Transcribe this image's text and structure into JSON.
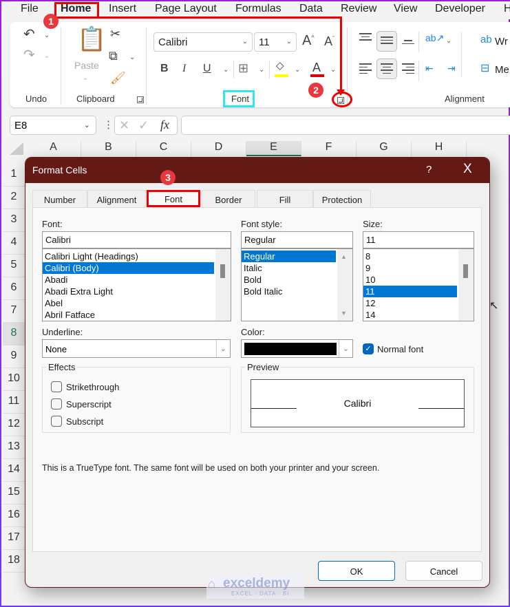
{
  "menu": {
    "tabs": [
      "File",
      "Home",
      "Insert",
      "Page Layout",
      "Formulas",
      "Data",
      "Review",
      "View",
      "Developer",
      "H"
    ],
    "active": "Home"
  },
  "ribbon": {
    "groups": {
      "undo": "Undo",
      "clipboard": "Clipboard",
      "font": "Font",
      "alignment": "Alignment"
    },
    "paste_label": "Paste",
    "font_name": "Calibri",
    "font_size": "11",
    "wrap_label": "Wr",
    "merge_label": "Me",
    "highlight_color": "#ffff00",
    "font_color": "#e00000"
  },
  "formula_bar": {
    "name_box": "E8",
    "formula": "",
    "fx_label": "fx"
  },
  "grid": {
    "columns": [
      "A",
      "B",
      "C",
      "D",
      "E",
      "F",
      "G",
      "H"
    ],
    "rows": [
      "1",
      "2",
      "3",
      "4",
      "5",
      "6",
      "7",
      "8",
      "9",
      "10",
      "11",
      "12",
      "13",
      "14",
      "15",
      "16",
      "17",
      "18"
    ],
    "active_column": "E",
    "active_row": "8"
  },
  "dialog": {
    "title": "Format Cells",
    "help": "?",
    "close": "X",
    "tabs": [
      "Number",
      "Alignment",
      "Font",
      "Border",
      "Fill",
      "Protection"
    ],
    "active_tab": "Font",
    "font_label": "Font:",
    "font_value": "Calibri",
    "font_list": [
      "Calibri Light (Headings)",
      "Calibri (Body)",
      "Abadi",
      "Abadi Extra Light",
      "Abel",
      "Abril Fatface"
    ],
    "font_selected": "Calibri (Body)",
    "style_label": "Font style:",
    "style_value": "Regular",
    "style_list": [
      "Regular",
      "Italic",
      "Bold",
      "Bold Italic"
    ],
    "style_selected": "Regular",
    "size_label": "Size:",
    "size_value": "11",
    "size_list": [
      "8",
      "9",
      "10",
      "11",
      "12",
      "14"
    ],
    "size_selected": "11",
    "underline_label": "Underline:",
    "underline_value": "None",
    "color_label": "Color:",
    "color_value": "#000000",
    "normal_font_label": "Normal font",
    "normal_font_checked": true,
    "effects_label": "Effects",
    "effects": [
      {
        "label": "Strikethrough",
        "checked": false
      },
      {
        "label": "Superscript",
        "checked": false
      },
      {
        "label": "Subscript",
        "checked": false
      }
    ],
    "preview_label": "Preview",
    "preview_text": "Calibri",
    "info_text": "This is a TrueType font.  The same font will be used on both your printer and your screen.",
    "ok": "OK",
    "cancel": "Cancel"
  },
  "annotations": {
    "steps": [
      "1",
      "2",
      "3"
    ]
  },
  "watermark": {
    "brand": "exceldemy",
    "tagline": "EXCEL · DATA · BI"
  }
}
